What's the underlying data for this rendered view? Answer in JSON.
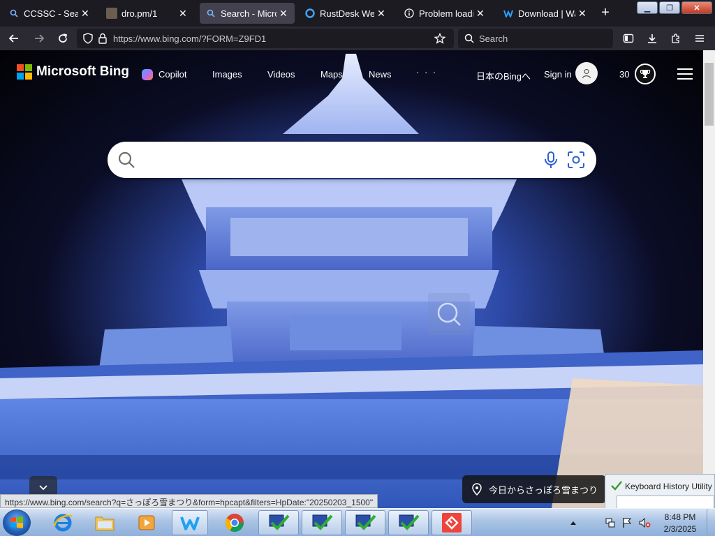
{
  "browser": {
    "tabs": [
      {
        "label": "CCSSC - Search",
        "icon": "search-icon",
        "active": false
      },
      {
        "label": "dro.pm/1",
        "icon": "page-thumbnail-icon",
        "active": false
      },
      {
        "label": "Search - Micros",
        "icon": "search-icon",
        "active": true
      },
      {
        "label": "RustDesk Web C",
        "icon": "rustdesk-icon",
        "active": false
      },
      {
        "label": "Problem loading",
        "icon": "info-icon",
        "active": false
      },
      {
        "label": "Download | Wat",
        "icon": "wattpad-icon",
        "active": false
      }
    ],
    "url": "https://www.bing.com/?FORM=Z9FD1",
    "search_placeholder": "Search"
  },
  "bing": {
    "brand": "Microsoft Bing",
    "nav": {
      "copilot": "Copilot",
      "images": "Images",
      "videos": "Videos",
      "maps": "Maps",
      "news": "News",
      "more": "· · ·"
    },
    "region_link": "日本のBingへ",
    "sign_in": "Sign in",
    "rewards_count": "30",
    "search_value": "",
    "image_caption": "今日からさっぽろ雪まつり",
    "status_url": "https://www.bing.com/search?q=さっぽろ雪まつり&form=hpcapt&filters=HpDate:\"20250203_1500\""
  },
  "popup": {
    "title": "Keyboard History Utility"
  },
  "taskbar": {
    "time": "8:48 PM",
    "date": "2/3/2025"
  },
  "colors": {
    "ms_red": "#f25022",
    "ms_green": "#7fba00",
    "ms_blue": "#00a4ef",
    "ms_yellow": "#ffb900",
    "tab_active": "#42414d",
    "navbar": "#2b2a33"
  }
}
